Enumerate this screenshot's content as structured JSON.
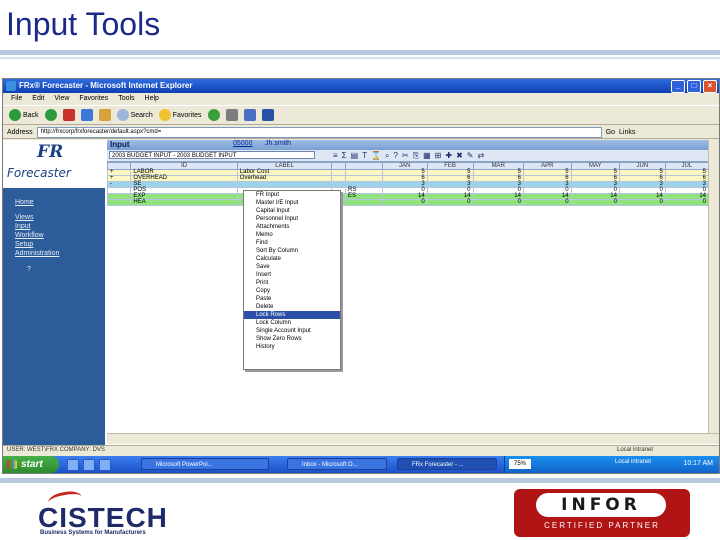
{
  "slide": {
    "title": "Input Tools"
  },
  "browser": {
    "window_title": "FRx® Forecaster - Microsoft Internet Explorer",
    "menu": [
      "File",
      "Edit",
      "View",
      "Favorites",
      "Tools",
      "Help"
    ],
    "toolbar": {
      "back": "Back",
      "search": "Search",
      "favorites": "Favorites"
    },
    "address_label": "Address",
    "address_value": "http://frxcorp/frxforecaster/default.aspx?cmd=",
    "go_label": "Go",
    "links_label": "Links"
  },
  "app": {
    "logo_mark": "FR",
    "logo_name": "Forecaster",
    "nav": [
      "Home",
      "Views",
      "Input",
      "Workflow",
      "Setup",
      "Administration"
    ],
    "nav_help": "?",
    "input_label": "Input",
    "code": "05000",
    "user": "Jh.smith",
    "budget_select": "2003 BUDGET INPUT - 2003 BUDGET INPUT",
    "toolbar_icons": [
      "≡",
      "Σ",
      "▤",
      "T",
      "⌛",
      "⌕",
      "?",
      "✂",
      "⎘",
      "▦",
      "⊞",
      "✚",
      "✖",
      "✎",
      "⇄"
    ],
    "grid": {
      "headers": [
        "",
        "ID",
        "LABEL",
        "",
        "",
        "JAN",
        "FEB",
        "MAR",
        "APR",
        "MAY",
        "JUN",
        "JUL"
      ],
      "rows": [
        {
          "style": "yellow",
          "cells": [
            "+",
            "LABOR",
            "Labor Cost",
            "",
            "",
            "5",
            "5",
            "5",
            "5",
            "5",
            "5",
            "5"
          ]
        },
        {
          "style": "yellow",
          "cells": [
            "+",
            "OVERHEAD",
            "Overhead",
            "",
            "",
            "6",
            "6",
            "6",
            "6",
            "6",
            "6",
            "6"
          ]
        },
        {
          "style": "blue",
          "cells": [
            "-",
            "SE",
            "",
            "",
            "",
            "3",
            "3",
            "3",
            "3",
            "3",
            "3",
            "3"
          ]
        },
        {
          "style": "white",
          "cells": [
            "",
            "POS",
            "",
            "",
            "RS",
            "0",
            "0",
            "0",
            "0",
            "0",
            "0",
            "0"
          ]
        },
        {
          "style": "green",
          "cells": [
            "",
            "EXP",
            "",
            "",
            "ES",
            "14",
            "14",
            "14",
            "14",
            "14",
            "14",
            "14"
          ]
        },
        {
          "style": "green",
          "cells": [
            "",
            "HEA",
            "",
            "",
            "",
            "0",
            "0",
            "0",
            "0",
            "0",
            "0",
            "0"
          ]
        }
      ]
    },
    "context_menu": {
      "items": [
        "FR Input",
        "Master I/E Input",
        "Capital Input",
        "Personnel Input",
        "Attachments",
        "Memo",
        "Find",
        "Sort By Column",
        "Calculate",
        "Save",
        "Insert",
        "Print",
        "Copy",
        "Paste",
        "Delete",
        "Lock Rows",
        "Lock Column",
        "Single Account Input",
        "Show Zero Rows",
        "History"
      ],
      "highlighted_index": 15
    },
    "status_left": "USER: WEST\\FRX  COMPANY: DVS",
    "status_right": "Local intranet"
  },
  "taskbar": {
    "start": "start",
    "tasks": [
      "Microsoft PowerPoi...",
      "Inbox - Microsoft O...",
      "FRx Forecaster - ..."
    ],
    "zoom": "75%",
    "tray_text": "Local intranet",
    "clock": "10:17 AM"
  },
  "logos": {
    "cistech_name": "CISTECH",
    "cistech_tag": "Business Systems for Manufacturers",
    "infor_word": "INFOR",
    "infor_cert": "CERTIFIED PARTNER"
  },
  "colors": {
    "title": "#1b2a8a",
    "row_yellow": "#fbf7c2",
    "row_blue": "#9bd4ea",
    "row_green": "#8fe27c",
    "menu_highlight": "#2c4fa8",
    "infor_red": "#b01414"
  }
}
